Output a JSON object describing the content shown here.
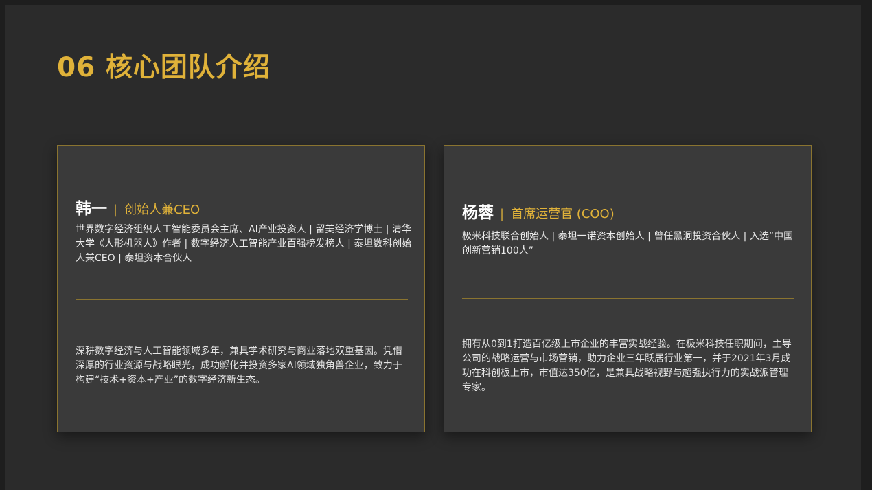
{
  "page": {
    "title": "06 核心团队介绍"
  },
  "colors": {
    "page_background": "#2b2b2b",
    "card_background": "#3a3a3a",
    "accent_gold": "#e0b239",
    "border_gold": "#8a7430",
    "text_white": "#ffffff"
  },
  "team": [
    {
      "name": "韩一",
      "separator": "|",
      "role": "创始人兼CEO",
      "credentials": "世界数字经济组织人工智能委员会主席、AI产业投资人 | 留美经济学博士 | 清华大学《人形机器人》作者 | 数字经济人工智能产业百强榜发榜人 | 泰坦数科创始人兼CEO | 泰坦资本合伙人",
      "bio": "深耕数字经济与人工智能领域多年，兼具学术研究与商业落地双重基因。凭借深厚的行业资源与战略眼光，成功孵化并投资多家AI领域独角兽企业，致力于构建“技术+资本+产业”的数字经济新生态。"
    },
    {
      "name": "杨蓉",
      "separator": "|",
      "role": "首席运营官 (COO)",
      "credentials": "极米科技联合创始人 | 泰坦一诺资本创始人 | 曾任黑洞投资合伙人 | 入选“中国创新营销100人”",
      "bio": "拥有从0到1打造百亿级上市企业的丰富实战经验。在极米科技任职期间，主导公司的战略运营与市场营销，助力企业三年跃居行业第一，并于2021年3月成功在科创板上市，市值达350亿，是兼具战略视野与超强执行力的实战派管理专家。"
    }
  ]
}
